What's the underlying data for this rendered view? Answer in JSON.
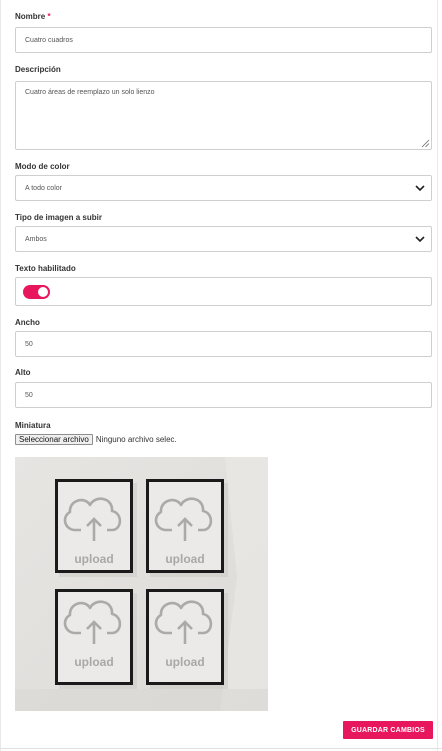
{
  "form": {
    "name": {
      "label": "Nombre",
      "required_mark": "*",
      "value": "Cuatro cuadros"
    },
    "description": {
      "label": "Descripción",
      "value": "Cuatro áreas de reemplazo un solo lienzo"
    },
    "color_mode": {
      "label": "Modo de color",
      "selected": "A todo color"
    },
    "image_type": {
      "label": "Tipo de imagen a subir",
      "selected": "Ambos"
    },
    "text_enabled": {
      "label": "Texto habilitado",
      "checked": true
    },
    "width": {
      "label": "Ancho",
      "value": "50"
    },
    "height": {
      "label": "Alto",
      "value": "50"
    },
    "thumbnail": {
      "label": "Miniatura",
      "file_button": "Seleccionar archivo",
      "file_status": "Ninguno archivo selec.",
      "preview_texts": [
        "upload",
        "upload",
        "upload",
        "upload"
      ]
    },
    "save_label": "GUARDAR CAMBIOS"
  },
  "colors": {
    "accent": "#e8175d",
    "border": "#cfcfcf"
  },
  "icons": {
    "select_arrow": "chevron-down-icon",
    "upload": "cloud-upload-icon"
  }
}
